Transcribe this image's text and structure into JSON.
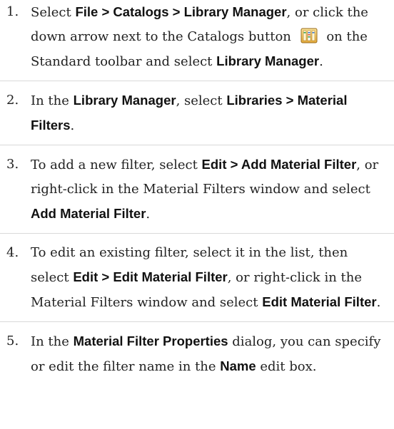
{
  "steps": [
    {
      "number": "1.",
      "segments": [
        {
          "text": "Select ",
          "ui": false
        },
        {
          "text": "File > Catalogs > Library Manager",
          "ui": true
        },
        {
          "text": ", or click the down arrow next to the Catalogs button ",
          "ui": false
        },
        {
          "icon": "catalogs-icon"
        },
        {
          "text": " on the Standard toolbar and select ",
          "ui": false
        },
        {
          "text": "Library Manager",
          "ui": true
        },
        {
          "text": ".",
          "ui": false
        }
      ]
    },
    {
      "number": "2.",
      "segments": [
        {
          "text": "In the ",
          "ui": false
        },
        {
          "text": "Library Manager",
          "ui": true
        },
        {
          "text": ", select ",
          "ui": false
        },
        {
          "text": "Libraries > Material Filters",
          "ui": true
        },
        {
          "text": ".",
          "ui": false
        }
      ]
    },
    {
      "number": "3.",
      "segments": [
        {
          "text": "To add a new filter, select ",
          "ui": false
        },
        {
          "text": "Edit > Add Material Filter",
          "ui": true
        },
        {
          "text": ", or right-click in the Material Filters window and select ",
          "ui": false
        },
        {
          "text": "Add Material Filter",
          "ui": true
        },
        {
          "text": ".",
          "ui": false
        }
      ]
    },
    {
      "number": "4.",
      "segments": [
        {
          "text": "To edit an existing filter, select it in the list, then select ",
          "ui": false
        },
        {
          "text": "Edit > Edit Material Filter",
          "ui": true
        },
        {
          "text": ", or right-click in the Material Filters window and select ",
          "ui": false
        },
        {
          "text": "Edit Material Filter",
          "ui": true
        },
        {
          "text": ".",
          "ui": false
        }
      ]
    },
    {
      "number": "5.",
      "segments": [
        {
          "text": "In the ",
          "ui": false
        },
        {
          "text": "Material Filter Properties",
          "ui": true
        },
        {
          "text": " dialog, you can specify or edit the filter name in the ",
          "ui": false
        },
        {
          "text": "Name",
          "ui": true
        },
        {
          "text": " edit box.",
          "ui": false
        }
      ]
    }
  ]
}
